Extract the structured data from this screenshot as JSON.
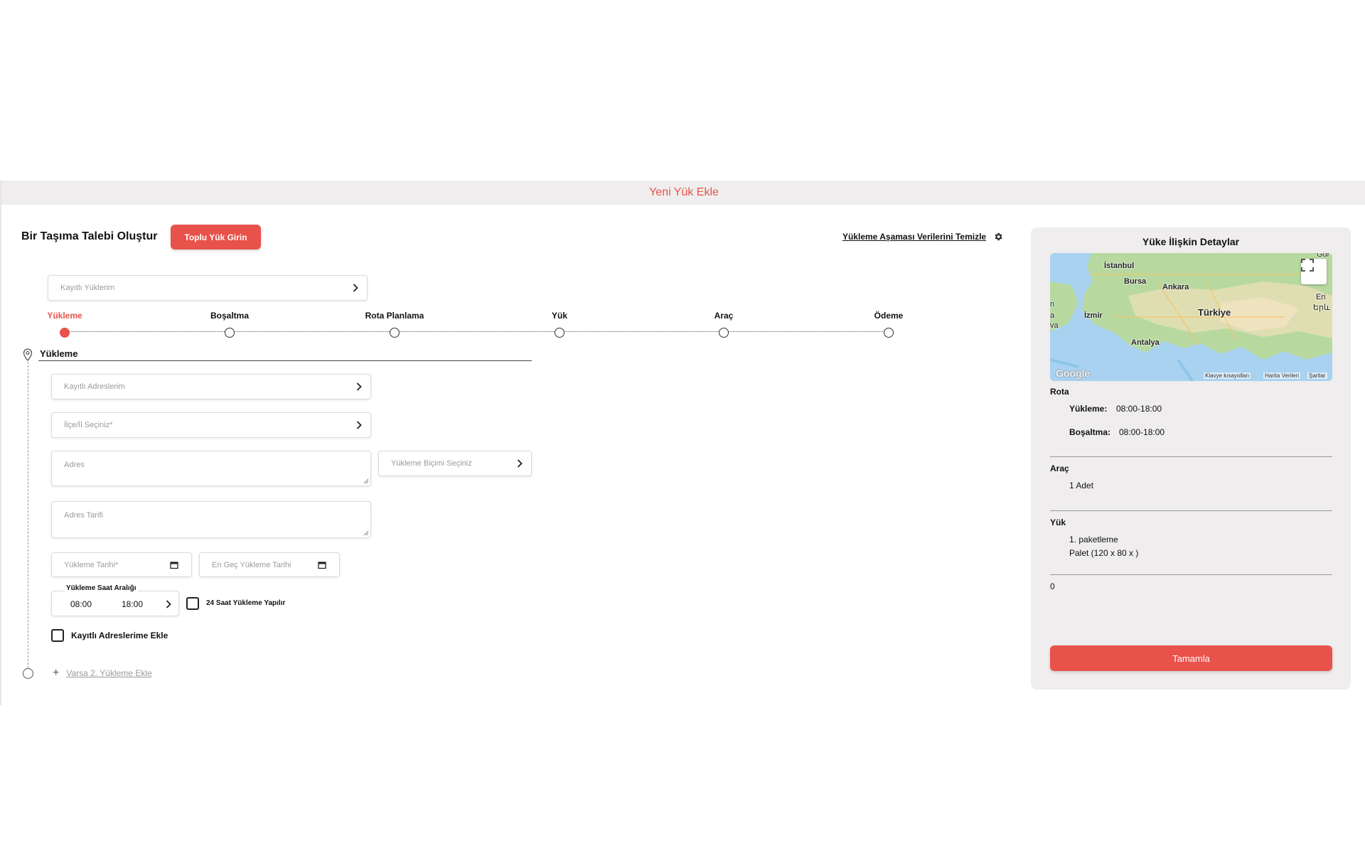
{
  "topbar": {
    "title": "Yeni Yük Ekle"
  },
  "header": {
    "title": "Bir Taşıma Talebi Oluştur",
    "bulk_button": "Toplu Yük Girin",
    "clear_link": "Yükleme Aşaması Verilerini Temizle"
  },
  "saved_loads": {
    "placeholder": "Kayıtlı Yüklerim"
  },
  "steps": [
    {
      "label": "Yükleme",
      "active": true
    },
    {
      "label": "Boşaltma"
    },
    {
      "label": "Rota Planlama"
    },
    {
      "label": "Yük"
    },
    {
      "label": "Araç"
    },
    {
      "label": "Ödeme"
    }
  ],
  "section": {
    "title": "Yükleme",
    "saved_addresses": "Kayıtlı Adreslerim",
    "district_city": "İlçe/İl Seçiniz*",
    "address": "Adres",
    "loading_type": "Yükleme Biçimi Seçiniz",
    "address_description": "Adres Tarifi",
    "loading_date": "Yükleme Tarihi*",
    "latest_loading_date": "En Geç Yükleme Tarihi",
    "time_range_label": "Yükleme Saat Aralığı",
    "time_start": "08:00",
    "time_end": "18:00",
    "all_day_label": "24 Saat Yükleme Yapılır",
    "add_saved_label": "Kayıtlı Adreslerime Ekle",
    "add_second_link": "Varsa 2. Yükleme Ekle"
  },
  "panel": {
    "title": "Yüke İlişkin Detaylar",
    "map": {
      "cities": [
        "İstanbul",
        "Bursa",
        "Ankara",
        "İzmir",
        "Antalya"
      ],
      "country": "Türkiye",
      "edge_labels": [
        "Eri",
        "Երև",
        "n",
        "a",
        "va"
      ],
      "attrib_keyboard": "Klavye kısayolları",
      "attrib_data": "Harita Verileri",
      "attrib_terms": "Şartlar",
      "logo": "Google",
      "corner_text": "Gür"
    },
    "route": {
      "head": "Rota",
      "loading_label": "Yükleme:",
      "loading_value": "08:00-18:00",
      "unloading_label": "Boşaltma:",
      "unloading_value": "08:00-18:00"
    },
    "vehicle": {
      "head": "Araç",
      "value": "1 Adet"
    },
    "load": {
      "head": "Yük",
      "line1": "1. paketleme",
      "line2": "Palet (120 x 80 x )"
    },
    "total": "0",
    "done_button": "Tamamla"
  },
  "colors": {
    "accent": "#e8524a",
    "panel_bg": "#efeded"
  }
}
